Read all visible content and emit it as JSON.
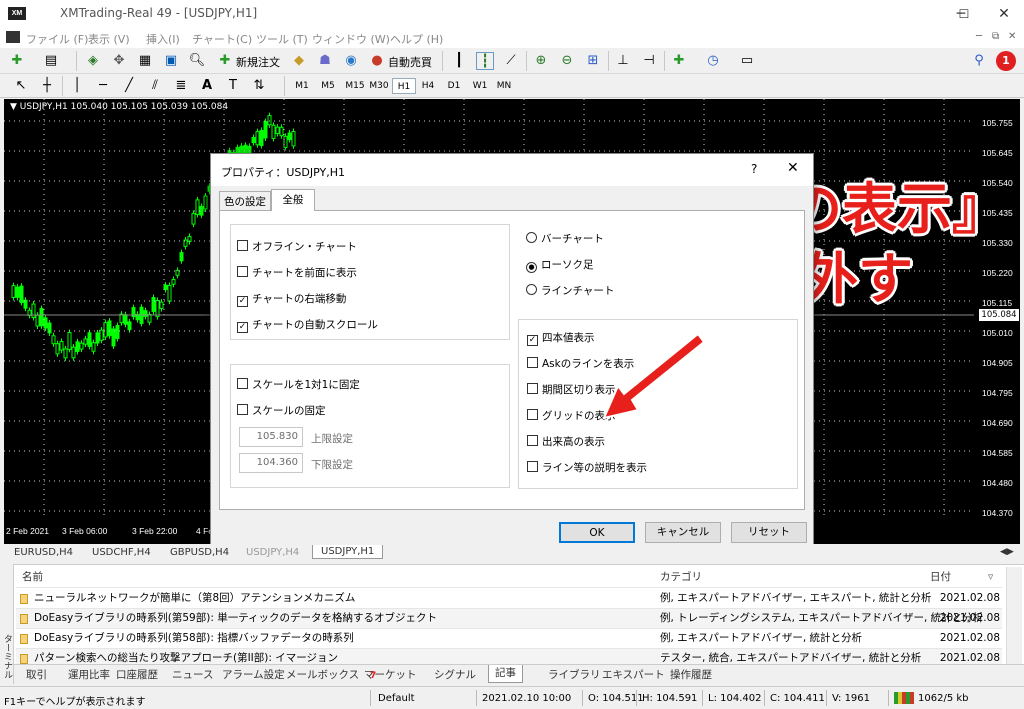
{
  "window": {
    "title": "XMTrading-Real 49 - [USDJPY,H1]",
    "app_name": "XM"
  },
  "menu": [
    "ファイル (F)",
    "表示 (V)",
    "挿入(I)",
    "チャート(C)",
    "ツール (T)",
    "ウィンドウ (W)",
    "ヘルプ (H)"
  ],
  "toolbar": {
    "new_order": "新規注文",
    "auto_trading": "自動売買",
    "notification_count": "1"
  },
  "timeframes": [
    "M1",
    "M5",
    "M15",
    "M30",
    "H1",
    "H4",
    "D1",
    "W1",
    "MN"
  ],
  "selected_timeframe": "H1",
  "chart": {
    "header": "USDJPY,H1  105.040 105.105 105.039 105.084",
    "price_labels": [
      "105.755",
      "105.645",
      "105.540",
      "105.435",
      "105.330",
      "105.220",
      "105.115",
      "105.010",
      "104.905",
      "104.795",
      "104.690",
      "104.585",
      "104.480",
      "104.370"
    ],
    "current_price": "105.084",
    "date_labels": [
      "2 Feb 2021",
      "3 Feb 06:00",
      "3 Feb 22:00",
      "4 Feb 1"
    ],
    "candle_color": "#00ff00"
  },
  "annotation": {
    "line1": "『グリッドの表示』",
    "line2": "チェックを外す",
    "color": "#e8201c"
  },
  "dialog": {
    "title": "プロパティ：USDJPY,H1",
    "help": "?",
    "close": "✕",
    "tabs": [
      "色の設定",
      "全般"
    ],
    "active_tab": "全般",
    "left_group": [
      {
        "label": "オフライン・チャート",
        "checked": false
      },
      {
        "label": "チャートを前面に表示",
        "checked": false
      },
      {
        "label": "チャートの右端移動",
        "checked": true
      },
      {
        "label": "チャートの自動スクロール",
        "checked": true
      }
    ],
    "scale_group": [
      {
        "label": "スケールを1対1に固定",
        "checked": false
      },
      {
        "label": "スケールの固定",
        "checked": false
      }
    ],
    "upper_value": "105.830",
    "upper_label": "上限設定",
    "lower_value": "104.360",
    "lower_label": "下限設定",
    "chart_types": [
      {
        "label": "バーチャート",
        "selected": false
      },
      {
        "label": "ローソク足",
        "selected": true
      },
      {
        "label": "ラインチャート",
        "selected": false
      }
    ],
    "right_group": [
      {
        "label": "四本値表示",
        "checked": true
      },
      {
        "label": "Askのラインを表示",
        "checked": false
      },
      {
        "label": "期間区切り表示",
        "checked": false
      },
      {
        "label": "グリッドの表示",
        "checked": false
      },
      {
        "label": "出来高の表示",
        "checked": false
      },
      {
        "label": "ライン等の説明を表示",
        "checked": false
      }
    ],
    "ok": "OK",
    "cancel": "キャンセル",
    "reset": "リセット"
  },
  "symbol_tabs": [
    "EURUSD,H4",
    "USDCHF,H4",
    "GBPUSD,H4",
    "USDJPY,H4",
    "USDJPY,H1"
  ],
  "terminal": {
    "side_label": "ターミナル",
    "columns": {
      "name": "名前",
      "category": "カテゴリ",
      "date": "日付"
    },
    "rows": [
      {
        "name": "ニューラルネットワークが簡単に（第8回）アテンションメカニズム",
        "category": "例, エキスパートアドバイザー, エキスパート, 統計と分析",
        "date": "2021.02.08"
      },
      {
        "name": "DoEasyライブラリの時系列(第59部): 単一ティックのデータを格納するオブジェクト",
        "category": "例, トレーディングシステム, エキスパートアドバイザー, 統計と分析",
        "date": "2021.02.08"
      },
      {
        "name": "DoEasyライブラリの時系列(第58部): 指標バッファデータの時系列",
        "category": "例, エキスパートアドバイザー, 統計と分析",
        "date": "2021.02.08"
      },
      {
        "name": "パターン検索への総当たり攻撃アプローチ(第II部): イマージョン",
        "category": "テスター, 統合, エキスパートアドバイザー, 統計と分析",
        "date": "2021.02.08"
      }
    ],
    "tabs": [
      "取引",
      "運用比率",
      "口座履歴",
      "ニュース",
      "アラーム設定",
      "メールボックス",
      "マーケット",
      "シグナル",
      "記事",
      "ライブラリ",
      "エキスパート",
      "操作履歴"
    ],
    "mailbox_badge": "7",
    "active_tab": "記事"
  },
  "status": {
    "help": "F1キーでヘルプが表示されます",
    "profile": "Default",
    "datetime": "2021.02.10 10:00",
    "open": "O: 104.511",
    "high": "H: 104.591",
    "low": "L: 104.402",
    "close": "C: 104.411",
    "volume": "V: 1961",
    "traffic": "1062/5 kb"
  }
}
